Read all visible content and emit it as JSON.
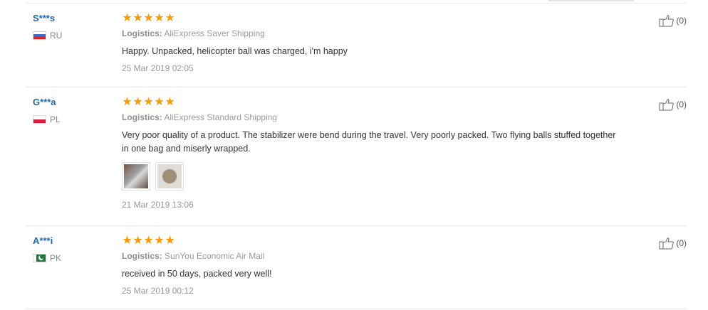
{
  "reviews": [
    {
      "user": "S***s",
      "country": "RU",
      "flag_icon": "russia-flag-icon",
      "stars": 5,
      "logistics_label": "Logistics:",
      "logistics": "AliExpress Saver Shipping",
      "text": "Happy. Unpacked, helicopter ball was charged, i'm happy",
      "date": "25 Mar 2019 02:05",
      "likes": "(0)",
      "photos": []
    },
    {
      "user": "G***a",
      "country": "PL",
      "flag_icon": "poland-flag-icon",
      "stars": 5,
      "logistics_label": "Logistics:",
      "logistics": "AliExpress Standard Shipping",
      "text": "Very poor quality of a product. The stabilizer were bend during the travel. Very poorly packed. Two flying balls stuffed together in one bag and miserly wrapped.",
      "date": "21 Mar 2019 13:06",
      "likes": "(0)",
      "photos": [
        "review-photo-thumbnail",
        "review-photo-thumbnail"
      ]
    },
    {
      "user": "A***i",
      "country": "PK",
      "flag_icon": "pakistan-flag-icon",
      "stars": 5,
      "logistics_label": "Logistics:",
      "logistics": "SunYou Economic Air Mail",
      "text": "received in 50 days, packed very well!",
      "date": "25 Mar 2019 00:12",
      "likes": "(0)",
      "photos": []
    }
  ],
  "colors": {
    "username": "#1b6ab1",
    "star": "#ff9a00",
    "meta_text": "#999999",
    "body_text": "#333333"
  },
  "icons": {
    "star": "star-icon",
    "like": "thumbs-up-icon"
  }
}
